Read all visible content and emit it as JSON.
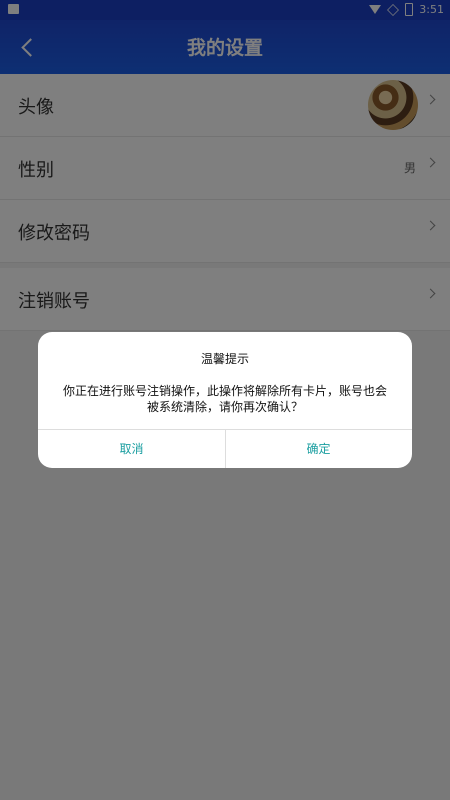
{
  "status_bar": {
    "time": "3:51",
    "icons": [
      "notification-icon",
      "wifi-icon",
      "signal-icon",
      "battery-icon"
    ]
  },
  "header": {
    "title": "我的设置",
    "back_icon": "back-arrow-icon"
  },
  "settings": [
    {
      "label": "头像",
      "value": "",
      "type": "avatar"
    },
    {
      "label": "性别",
      "value": "男"
    },
    {
      "label": "修改密码",
      "value": ""
    },
    {
      "label": "注销账号",
      "value": ""
    }
  ],
  "dialog": {
    "title": "温馨提示",
    "message": "你正在进行账号注销操作，此操作将解除所有卡片，账号也会被系统清除，请你再次确认？",
    "cancel_label": "取消",
    "confirm_label": "确定"
  },
  "colors": {
    "header_bg": "#1f48d0",
    "dialog_button_text": "#1a9ea0",
    "overlay": "rgba(0,0,0,0.5)"
  }
}
